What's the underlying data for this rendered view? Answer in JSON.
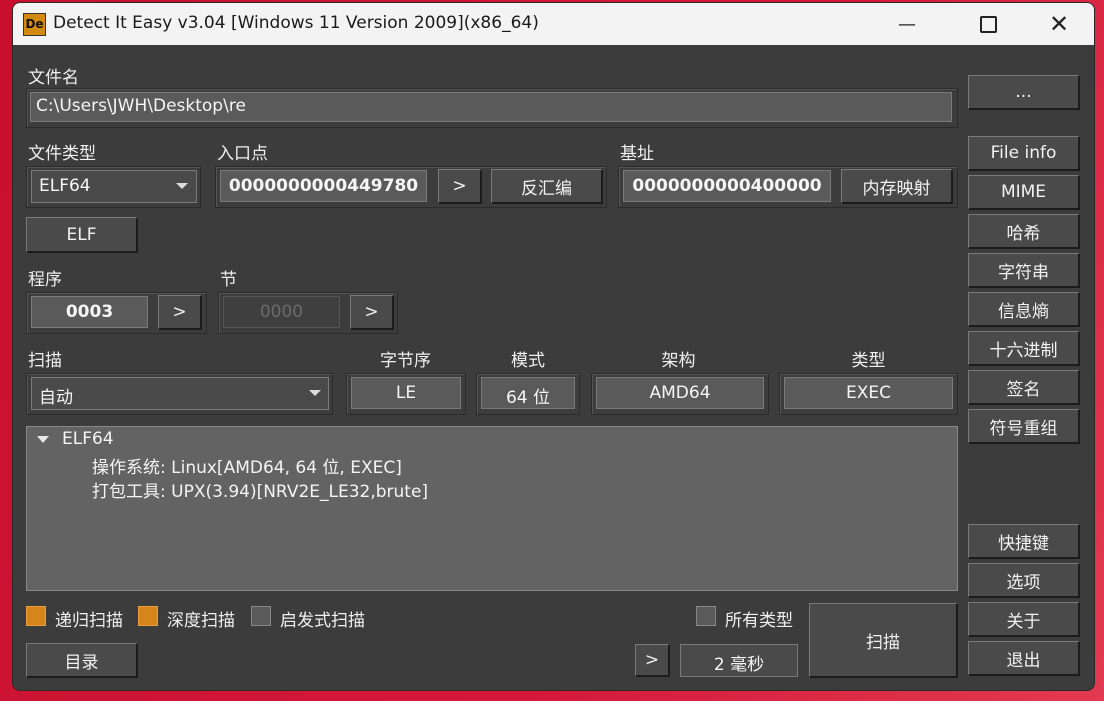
{
  "window": {
    "title": "Detect It Easy v3.04 [Windows 11 Version 2009](x86_64)",
    "icon_text": "De"
  },
  "file": {
    "label": "文件名",
    "path": "C:\\Users\\JWH\\Desktop\\re",
    "browse_label": "..."
  },
  "file_type": {
    "label": "文件类型",
    "value": "ELF64",
    "badge": "ELF"
  },
  "entry_point": {
    "label": "入口点",
    "value": "0000000000449780",
    "go_label": ">",
    "disasm_label": "反汇编"
  },
  "base_address": {
    "label": "基址",
    "value": "0000000000400000",
    "memmap_label": "内存映射"
  },
  "program": {
    "label": "程序",
    "value": "0003",
    "go_label": ">"
  },
  "section": {
    "label": "节",
    "value": "0000",
    "go_label": ">"
  },
  "scan": {
    "label": "扫描",
    "mode": "自动"
  },
  "info": {
    "endian_label": "字节序",
    "endian": "LE",
    "mode_label": "模式",
    "mode": "64 位",
    "arch_label": "架构",
    "arch": "AMD64",
    "type_label": "类型",
    "type": "EXEC"
  },
  "results": {
    "root": "ELF64",
    "lines": [
      "操作系统: Linux[AMD64, 64 位, EXEC]",
      "打包工具: UPX(3.94)[NRV2E_LE32,brute]"
    ]
  },
  "options": {
    "recursive": {
      "label": "递归扫描",
      "checked": true
    },
    "deep": {
      "label": "深度扫描",
      "checked": true
    },
    "heuristic": {
      "label": "启发式扫描",
      "checked": false
    },
    "all_types": {
      "label": "所有类型",
      "checked": false
    }
  },
  "bottom": {
    "dir_label": "目录",
    "log_label": ">",
    "time": "2 毫秒",
    "scan_label": "扫描"
  },
  "side_buttons": [
    "File info",
    "MIME",
    "哈希",
    "字符串",
    "信息熵",
    "十六进制",
    "签名",
    "符号重组"
  ],
  "side_bottom": [
    "快捷键",
    "选项",
    "关于",
    "退出"
  ],
  "colors": {
    "accent_checkbox": "#d6861a",
    "window_bg": "#3c3c3c",
    "titlebar": "#f3f3f3"
  }
}
